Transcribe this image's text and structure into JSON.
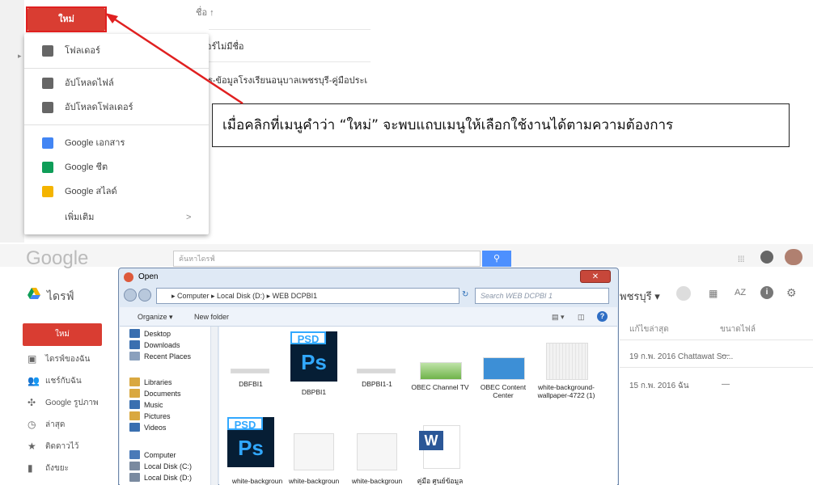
{
  "top": {
    "new_label": "ใหม่",
    "menu": [
      {
        "label": "โฟลเดอร์",
        "icon": "new-folder-icon"
      },
      {
        "label": "อัปโหลดไฟล์",
        "icon": "upload-file-icon"
      },
      {
        "label": "อัปโหลดโฟลเดอร์",
        "icon": "upload-folder-icon"
      },
      {
        "label": "Google เอกสาร",
        "icon": "docs-icon"
      },
      {
        "label": "Google ชีต",
        "icon": "sheets-icon"
      },
      {
        "label": "Google สไลด์",
        "icon": "slides-icon"
      },
      {
        "label": "เพิ่มเติม",
        "icon": "chevron-right-icon",
        "arrow": ">"
      }
    ],
    "list_header": "ชื่อ ↑",
    "list_rows": [
      "เดอร์ไม่มีชื่อ",
      "สาร-ข้อมูลโรงเรียนอนุบาลเพชรบุรี-คู่มือประเ"
    ],
    "callout": "เมื่อคลิกที่เมนูคำว่า  “ใหม่”  จะพบแถบเมนูให้เลือกใช้งานได้ตามความต้องการ"
  },
  "bottom": {
    "logo": "Google",
    "search_placeholder": "ค้นหาไดรฟ์",
    "drive_title": "ไดรฟ์",
    "new_label": "ใหม่",
    "sidebar": [
      {
        "label": "ไดรฟ์ของฉัน",
        "icon": "my-drive-icon"
      },
      {
        "label": "แชร์กับฉัน",
        "icon": "shared-icon"
      },
      {
        "label": "Google รูปภาพ",
        "icon": "photos-icon"
      },
      {
        "label": "ล่าสุด",
        "icon": "recent-icon"
      },
      {
        "label": "ติดดาวไว้",
        "icon": "star-icon"
      },
      {
        "label": "ถังขยะ",
        "icon": "trash-icon"
      }
    ],
    "breadcrumb": "พชรบุรี ▾",
    "col_modified": "แก้ไขล่าสุด",
    "col_size": "ขนาดไฟล์",
    "rows": [
      {
        "modified": "19 ก.พ. 2016 Chattawat So...",
        "size": "—"
      },
      {
        "modified": "15 ก.พ. 2016 ฉัน",
        "size": "—"
      }
    ],
    "dialog": {
      "title": "Open",
      "close": "✕",
      "path": "▸ Computer ▸ Local Disk (D:) ▸ WEB DCPBI1",
      "search_placeholder": "Search WEB DCPBI 1",
      "organize": "Organize ▾",
      "new_folder": "New folder",
      "nav": [
        {
          "label": "Desktop",
          "color": "#3a6fb0"
        },
        {
          "label": "Downloads",
          "color": "#3a6fb0"
        },
        {
          "label": "Recent Places",
          "color": "#8aa0bd"
        },
        {
          "label": "Libraries",
          "color": "#d9a840"
        },
        {
          "label": "Documents",
          "color": "#d9a840"
        },
        {
          "label": "Music",
          "color": "#3a6fb0"
        },
        {
          "label": "Pictures",
          "color": "#d9a840"
        },
        {
          "label": "Videos",
          "color": "#3a6fb0"
        },
        {
          "label": "Computer",
          "color": "#4a7ab8"
        },
        {
          "label": "Local Disk (C:)",
          "color": "#7a8aa0"
        },
        {
          "label": "Local Disk (D:)",
          "color": "#7a8aa0"
        }
      ],
      "files_row1": [
        "DBFBI1",
        "DBPBI1",
        "DBPBI1-1",
        "OBEC Channel TV",
        "OBEC Content Center",
        "white-background-wallpaper-4722 (1)"
      ],
      "files_row2": [
        "",
        "white-backgroun",
        "white-backgroun",
        "white-backgroun",
        "คู่มือ ศูนย์ข้อมูล"
      ],
      "psd_tag": "PSD",
      "psd_letters": "Ps"
    }
  },
  "colors": {
    "new_button": "#d93d32",
    "callout_arrow": "#e02020",
    "ps_bg": "#061e35",
    "ps_text": "#31a8ff"
  }
}
